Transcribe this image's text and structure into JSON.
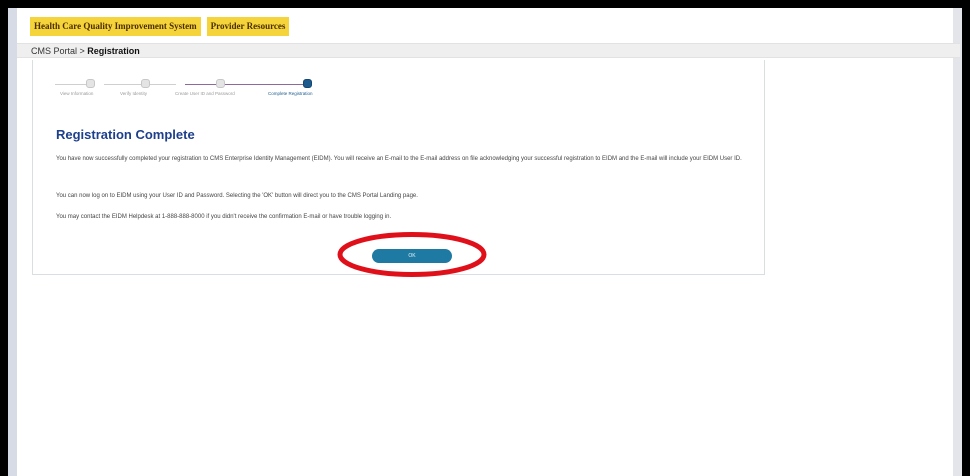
{
  "topnav": {
    "items": [
      {
        "label": "Health Care Quality Improvement System"
      },
      {
        "label": "Provider Resources"
      }
    ]
  },
  "breadcrumb": {
    "parent": "CMS Portal",
    "separator": " > ",
    "current": "Registration"
  },
  "stepper": {
    "steps": [
      {
        "label": "View Information",
        "state": "done"
      },
      {
        "label": "Verify Identity",
        "state": "done"
      },
      {
        "label": "Create User ID and Password",
        "state": "done"
      },
      {
        "label": "Complete Registration",
        "state": "current"
      }
    ]
  },
  "main": {
    "title": "Registration Complete",
    "paragraphs": [
      "You have now successfully completed your registration to CMS Enterprise Identity Management (EIDM). You will receive an E-mail to the E-mail address on file acknowledging your successful registration to EIDM and the E-mail will include your EIDM User ID.",
      "You can now log on to EIDM using your User ID and Password. Selecting the 'OK' button will direct you to the CMS Portal Landing page.",
      "You may contact the EIDM Helpdesk at 1-888-888-8000 if you didn't receive the confirmation E-mail or have trouble logging in."
    ],
    "ok_label": "OK"
  },
  "colors": {
    "nav_yellow": "#f5d33a",
    "heading_blue": "#1e3f8a",
    "button_teal": "#1f7aa3",
    "highlight_red": "#e0101a"
  }
}
